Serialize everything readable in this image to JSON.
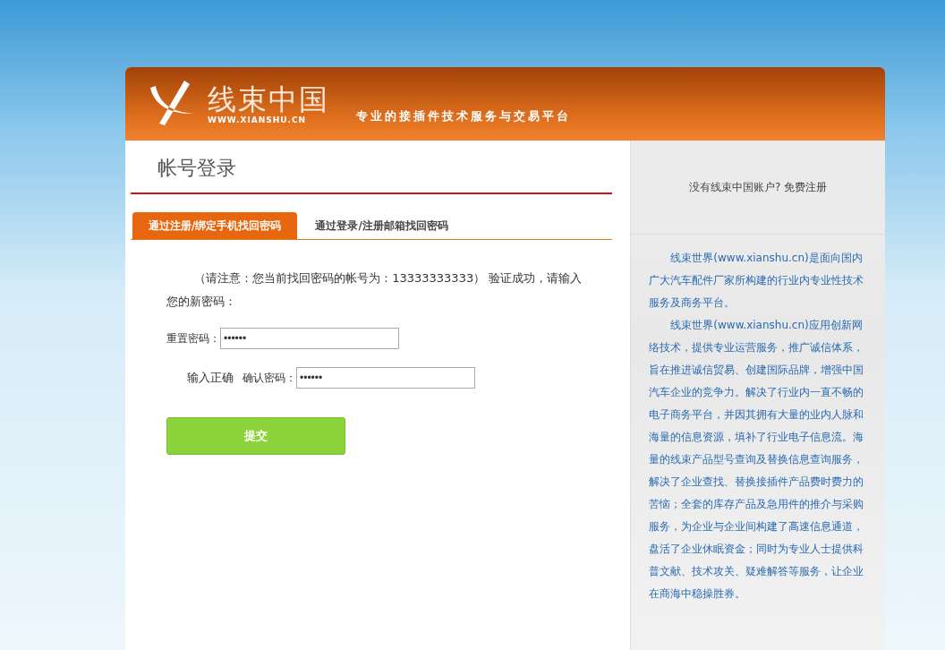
{
  "header": {
    "logo_text": "线束中国",
    "logo_url": "WWW.XIANSHU.CN",
    "tagline": "专业的接插件技术服务与交易平台"
  },
  "login": {
    "title": "帐号登录",
    "tabs": [
      {
        "label": "通过注册/绑定手机找回密码",
        "selected": true
      },
      {
        "label": "通过登录/注册邮箱找回密码",
        "selected": false
      }
    ],
    "notice": "（请注意：您当前找回密码的帐号为：13333333333） 验证成功，请输入您的新密码：",
    "fields": [
      {
        "label": "重置密码：",
        "value": "••••••"
      },
      {
        "hint": "输入正确",
        "label": "确认密码：",
        "value": "••••••"
      }
    ],
    "submit": "提交"
  },
  "sidebar": {
    "register_prompt": "没有线束中国账户? 免费注册",
    "paragraphs": [
      "线束世界(www.xianshu.cn)是面向国内广大汽车配件厂家所构建的行业内专业性技术服务及商务平台。",
      "线束世界(www.xianshu.cn)应用创新网络技术，提供专业运营服务，推广诚信体系，旨在推进诚信贸易、创建国际品牌，增强中国汽车企业的竞争力。解决了行业内一直不畅的电子商务平台，并因其拥有大量的业内人脉和海量的信息资源，填补了行业电子信息流。海量的线束产品型号查询及替换信息查询服务，解决了企业查找、替换接插件产品费时费力的苦恼；全套的库存产品及急用件的推介与采购服务，为企业与企业间构建了高速信息通道，盘活了企业休眠资金；同时为专业人士提供科普文献、技术攻关、疑难解答等服务，让企业在商海中稳操胜券。"
    ]
  }
}
